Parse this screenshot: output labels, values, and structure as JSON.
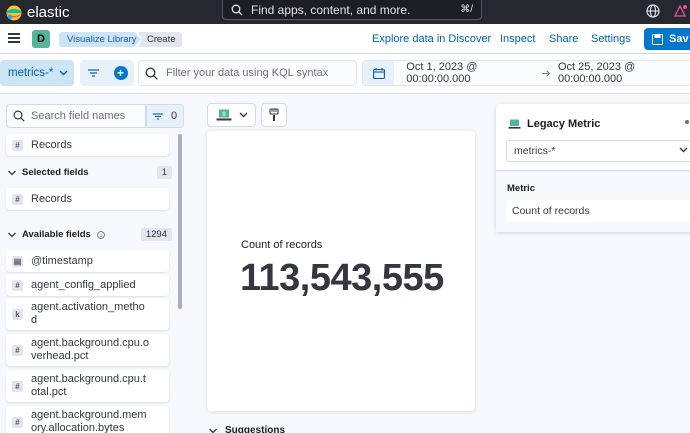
{
  "app": {
    "brand": "elastic"
  },
  "header": {
    "search_placeholder": "Find apps, content, and more.",
    "search_shortcut": "⌘/"
  },
  "nav": {
    "space_initial": "D",
    "breadcrumbs": [
      "Visualize Library",
      "Create"
    ],
    "links": {
      "explore": "Explore data in Discover",
      "inspect": "Inspect",
      "share": "Share",
      "settings": "Settings"
    },
    "save_label": "Sav"
  },
  "query": {
    "data_view": "metrics-*",
    "kql_placeholder": "Filter your data using KQL syntax",
    "time_start": "Oct 1, 2023 @ 00:00:00.000",
    "time_end": "Oct 25, 2023 @ 00:00:00.000"
  },
  "fields": {
    "search_placeholder": "Search field names",
    "filter_count": "0",
    "records_top": "Records",
    "selected_label": "Selected fields",
    "selected_count": "1",
    "selected_items": [
      "Records"
    ],
    "available_label": "Available fields",
    "available_count": "1294",
    "available_items": [
      {
        "type": "date",
        "name": "@timestamp"
      },
      {
        "type": "#",
        "name": "agent_config_applied"
      },
      {
        "type": "k",
        "name": "agent.activation_metho\nd"
      },
      {
        "type": "#",
        "name": "agent.background.cpu.o\nverhead.pct"
      },
      {
        "type": "#",
        "name": "agent.background.cpu.t\notal.pct"
      },
      {
        "type": "#",
        "name": "agent.background.mem\nory.allocation.bytes"
      }
    ]
  },
  "workspace": {
    "metric_label": "Count of records",
    "metric_value": "113,543,555",
    "suggestions_label": "Suggestions"
  },
  "config": {
    "title": "Legacy Metric",
    "layer_data_view": "metrics-*",
    "metric_section_label": "Metric",
    "metric_dimension": "Count of records"
  },
  "colors": {
    "header_bg": "#25282f",
    "primary": "#0077cc",
    "link": "#0061a6"
  }
}
